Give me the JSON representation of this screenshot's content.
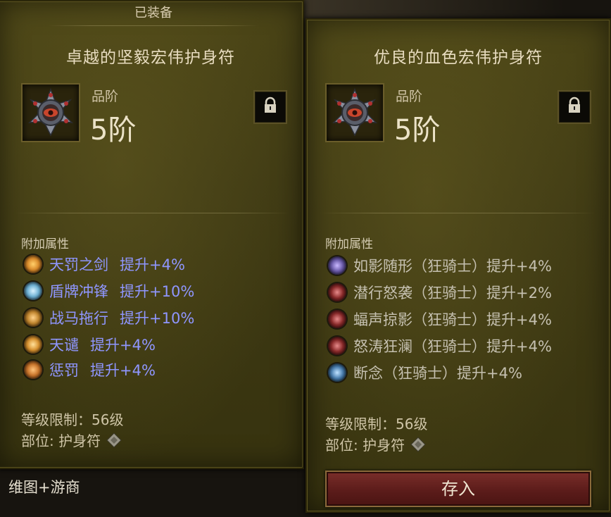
{
  "left": {
    "tab": "已装备",
    "title": "卓越的坚毅宏伟护身符",
    "tier_label": "品阶",
    "tier_value": "5阶",
    "affix_header": "附加属性",
    "affixes": [
      {
        "name": "天罚之剑",
        "bonus": "提升+4%",
        "icon_color": "#d98a2a"
      },
      {
        "name": "盾牌冲锋",
        "bonus": "提升+10%",
        "icon_color": "#6fb3d6"
      },
      {
        "name": "战马拖行",
        "bonus": "提升+10%",
        "icon_color": "#c2862e"
      },
      {
        "name": "天谴",
        "bonus": "提升+4%",
        "icon_color": "#d9922f"
      },
      {
        "name": "惩罚",
        "bonus": "提升+4%",
        "icon_color": "#c9742a"
      }
    ],
    "level_req": "等级限制：56级",
    "slot": "部位: 护身符"
  },
  "right": {
    "title": "优良的血色宏伟护身符",
    "tier_label": "品阶",
    "tier_value": "5阶",
    "affix_header": "附加属性",
    "affixes": [
      {
        "text": "如影随形（狂骑士）提升+4%",
        "icon_color": "#6a5aa8"
      },
      {
        "text": "潜行怒袭（狂骑士）提升+2%",
        "icon_color": "#8a2a2a"
      },
      {
        "text": "蝠声掠影（狂骑士）提升+4%",
        "icon_color": "#8a2a2a"
      },
      {
        "text": "怒涛狂澜（狂骑士）提升+4%",
        "icon_color": "#8a2a2a"
      },
      {
        "text": "断念（狂骑士）提升+4%",
        "icon_color": "#4a7fb0"
      }
    ],
    "level_req": "等级限制：56级",
    "slot": "部位: 护身符",
    "store_button": "存入"
  },
  "bottom_text": "维图+游商",
  "colors": {
    "panel_olive": "#4a4416",
    "affix_blue": "#8f96ff",
    "affix_gray": "#c5c0b0",
    "button_red": "#6a2421"
  },
  "icons": [
    "amulet-icon",
    "lock-icon",
    "slot-amulet-icon"
  ]
}
